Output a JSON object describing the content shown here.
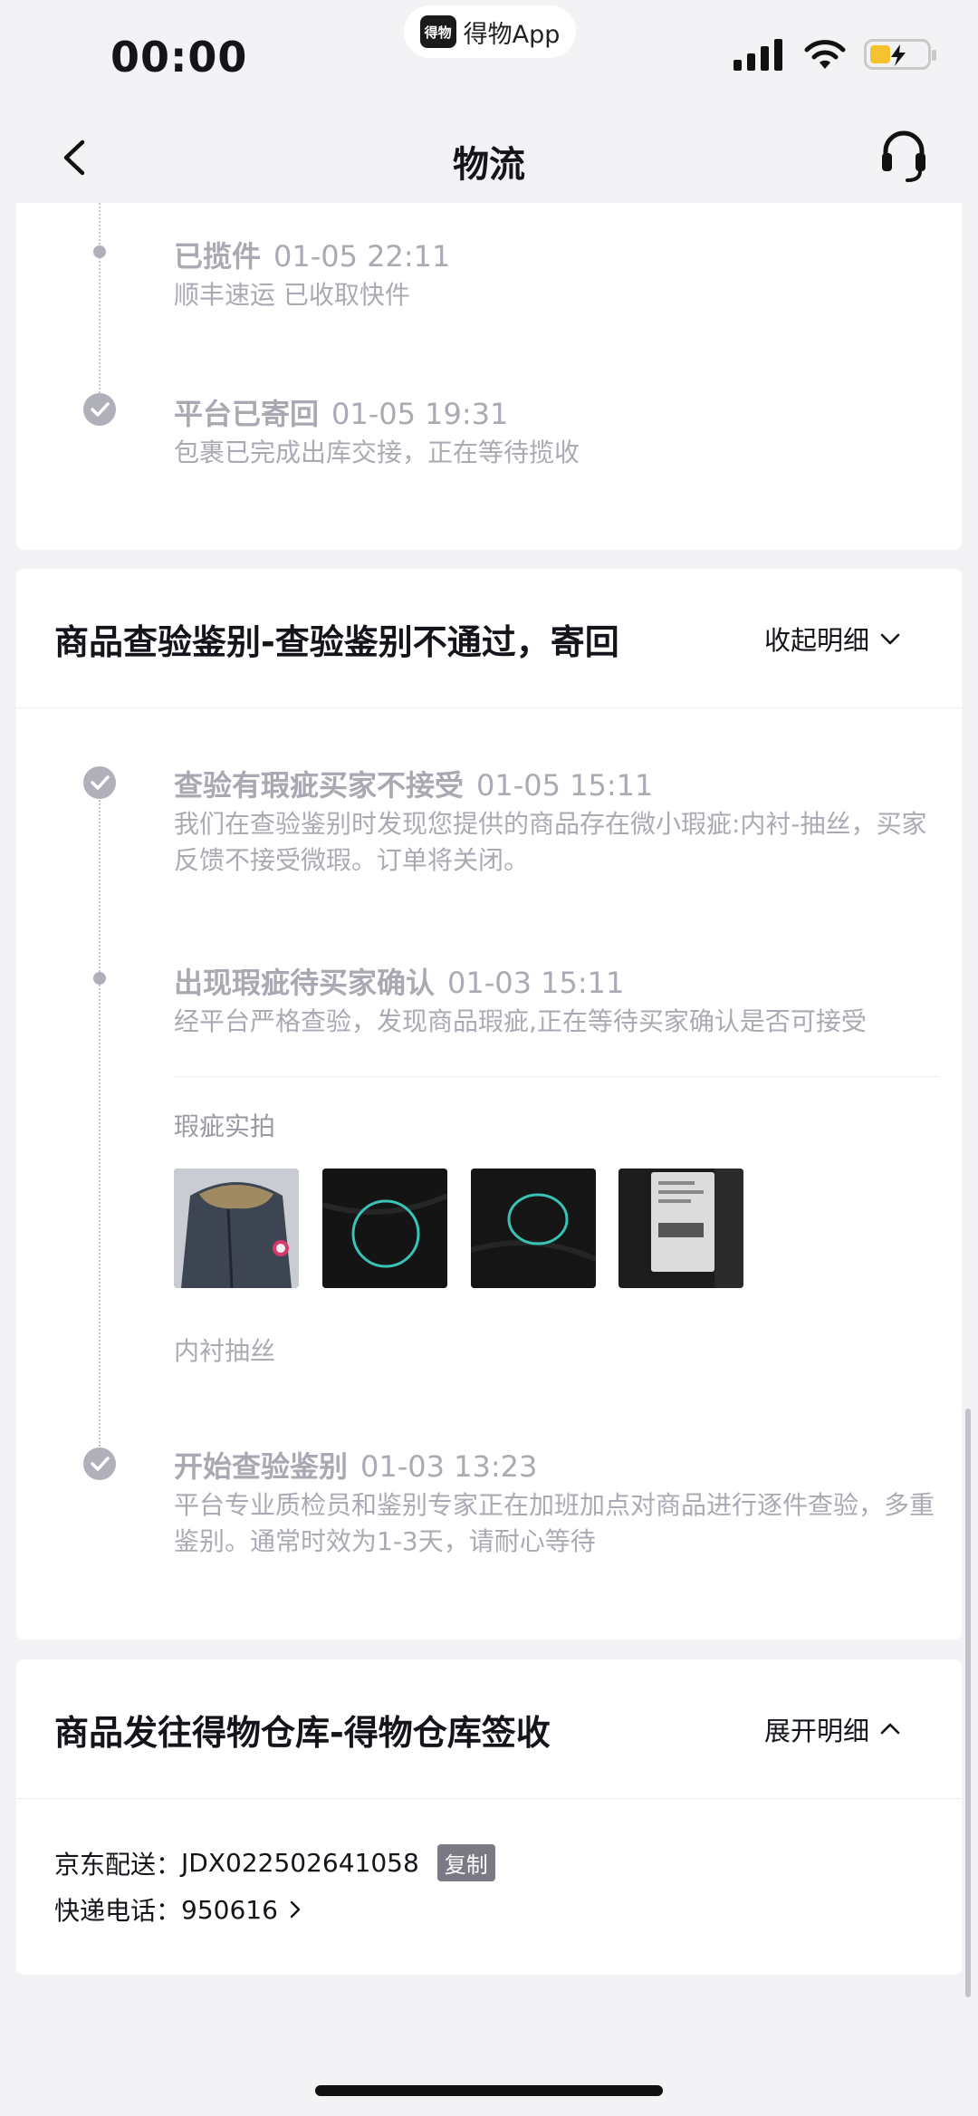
{
  "status_bar": {
    "time": "00:00",
    "app_badge": "得物App",
    "app_logo_text": "得物"
  },
  "nav": {
    "title": "物流"
  },
  "timeline_top": [
    {
      "title": "已揽件",
      "time": "01-05 22:11",
      "desc": "顺丰速运 已收取快件"
    },
    {
      "title": "平台已寄回",
      "time": "01-05 19:31",
      "desc": "包裹已完成出库交接，正在等待揽收"
    }
  ],
  "inspection": {
    "title": "商品查验鉴别-查验鉴别不通过，寄回",
    "toggle_label": "收起明细",
    "events": [
      {
        "title": "查验有瑕疵买家不接受",
        "time": "01-05 15:11",
        "desc": "我们在查验鉴别时发现您提供的商品存在微小瑕疵:内衬-抽丝，买家反馈不接受微瑕。订单将关闭。"
      },
      {
        "title": "出现瑕疵待买家确认",
        "time": "01-03 15:11",
        "desc": "经平台严格查验，发现商品瑕疵,正在等待买家确认是否可接受"
      },
      {
        "title": "开始查验鉴别",
        "time": "01-03 13:23",
        "desc": "平台专业质检员和鉴别专家正在加班加点对商品进行逐件查验，多重鉴别。通常时效为1-3天，请耐心等待"
      }
    ],
    "photos_label": "瑕疵实拍",
    "photo_caption": "内衬抽丝"
  },
  "warehouse": {
    "title": "商品发往得物仓库-得物仓库签收",
    "toggle_label": "展开明细",
    "carrier_label": "京东配送：",
    "tracking_no": "JDX022502641058",
    "copy_label": "复制",
    "phone_label": "快递电话：",
    "phone": "950616"
  },
  "colors": {
    "background": "#f3f3f6",
    "card": "#ffffff",
    "muted_text": "#aaaab4",
    "copy_badge": "#7a7a84"
  }
}
